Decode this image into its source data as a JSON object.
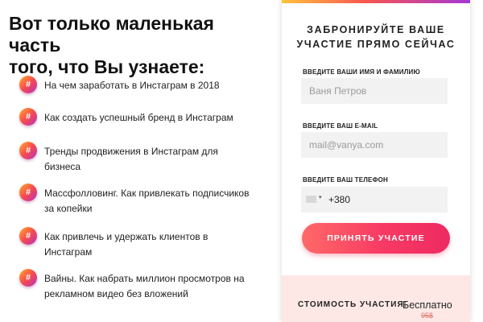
{
  "heading": {
    "line1": "Вот только маленькая часть",
    "line2": "того, что Вы узнаете:"
  },
  "features": [
    {
      "icon": "hashtag-icon",
      "icon_glyph": "#",
      "text": "На чем заработать в Инстаграм в 2018"
    },
    {
      "icon": "hashtag-icon",
      "icon_glyph": "#",
      "text": "Как создать успешный бренд в Инстаграм"
    },
    {
      "icon": "hashtag-icon",
      "icon_glyph": "#",
      "text": "Тренды продвижения в Инстаграм для бизнеса"
    },
    {
      "icon": "hashtag-icon",
      "icon_glyph": "#",
      "text": "Массфолловинг. Как привлекать подписчиков за копейки"
    },
    {
      "icon": "hashtag-icon",
      "icon_glyph": "#",
      "text": "Как привлечь и удержать клиентов в Инстаграм"
    },
    {
      "icon": "hashtag-icon",
      "icon_glyph": "#",
      "text": "Вайны. Как набрать миллион просмотров на рекламном видео без вложений"
    }
  ],
  "form": {
    "title_line1": "Забронируйте ваше",
    "title_line2": "участие прямо сейчас",
    "name_label": "ВВЕДИТЕ ВАШИ ИМЯ И ФАМИЛИЮ",
    "name_placeholder": "Ваня Петров",
    "email_label": "ВВЕДИТЕ ВАШ E-MAIL",
    "email_placeholder": "mail@vanya.com",
    "phone_label": "ВВЕДИТЕ ВАШ ТЕЛЕФОН",
    "phone_value": "+380",
    "phone_caret": "▾",
    "submit_label": "Принять участие"
  },
  "price": {
    "label": "Стоимость участия:",
    "value": "Бесплатно",
    "old_value": "95$"
  },
  "colors": {
    "accent_start": "#ff6968",
    "accent_end": "#ee2a62",
    "icon_gradient": [
      "#ffb02e",
      "#f74a4a",
      "#b531c9"
    ],
    "top_bar_gradient": [
      "#ffc23d",
      "#f7554f",
      "#a437d6"
    ],
    "price_background": "#fde8e6"
  }
}
